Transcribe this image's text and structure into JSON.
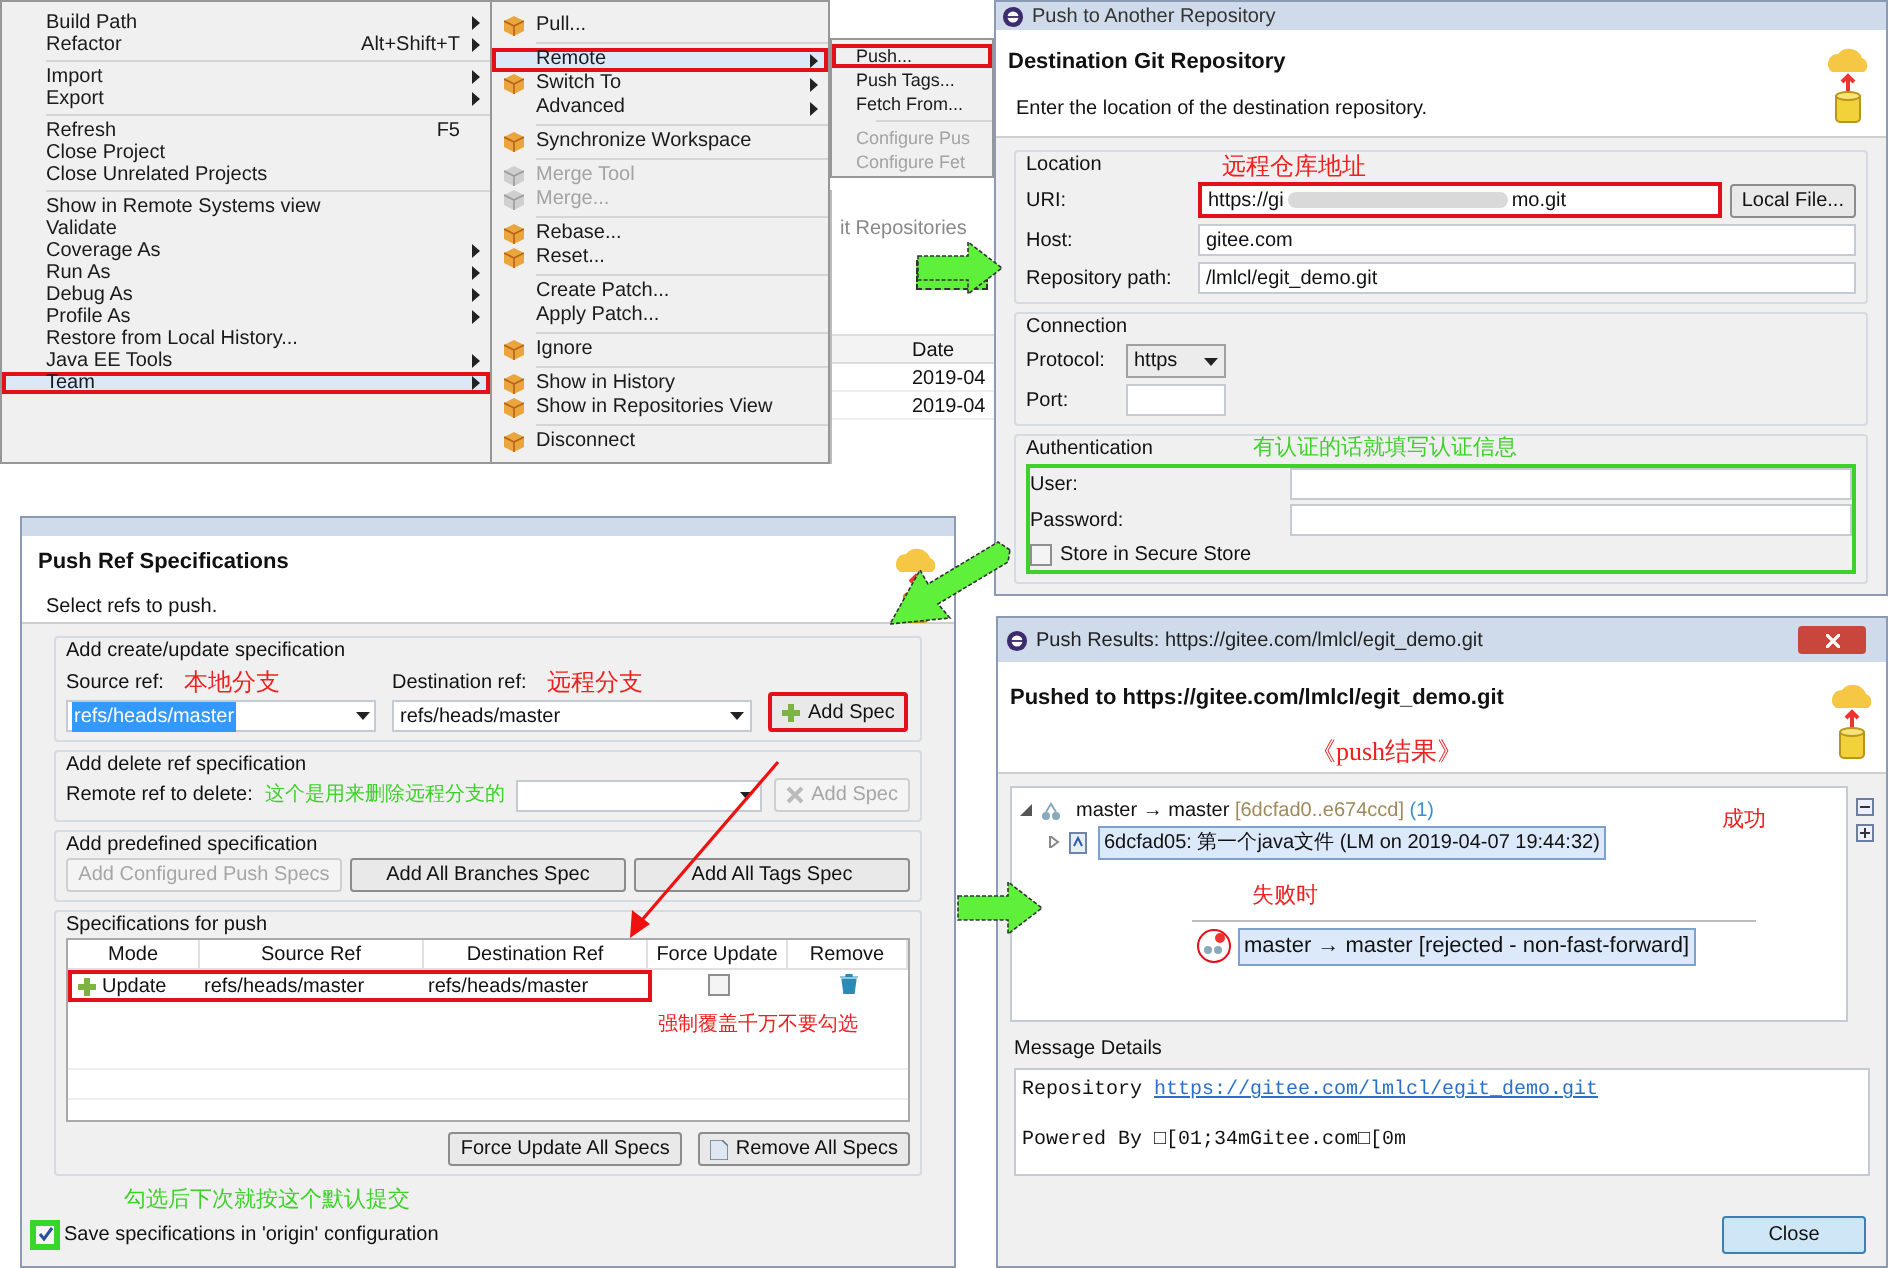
{
  "context_menu": {
    "groups": [
      [
        {
          "label": "Build Path",
          "submenu": true,
          "selected": false,
          "highlighted": false,
          "disabled": false
        },
        {
          "label": "Refactor",
          "shortcut": "Alt+Shift+T",
          "submenu": true,
          "selected": false,
          "highlighted": false,
          "disabled": false
        }
      ],
      [
        {
          "label": "Import",
          "submenu": true,
          "selected": false,
          "highlighted": false,
          "disabled": false
        },
        {
          "label": "Export",
          "submenu": true,
          "selected": false,
          "highlighted": false,
          "disabled": false
        }
      ],
      [
        {
          "label": "Refresh",
          "shortcut": "F5",
          "submenu": false,
          "selected": false,
          "highlighted": false,
          "disabled": false
        },
        {
          "label": "Close Project",
          "submenu": false,
          "selected": false,
          "highlighted": false,
          "disabled": false
        },
        {
          "label": "Close Unrelated Projects",
          "submenu": false,
          "selected": false,
          "highlighted": false,
          "disabled": false
        }
      ],
      [
        {
          "label": "Show in Remote Systems view",
          "submenu": false,
          "selected": false,
          "highlighted": false,
          "disabled": false
        },
        {
          "label": "Validate",
          "submenu": false,
          "selected": false,
          "highlighted": false,
          "disabled": false
        },
        {
          "label": "Coverage As",
          "submenu": true,
          "selected": false,
          "highlighted": false,
          "disabled": false
        },
        {
          "label": "Run As",
          "submenu": true,
          "selected": false,
          "highlighted": false,
          "disabled": false
        },
        {
          "label": "Debug As",
          "submenu": true,
          "selected": false,
          "highlighted": false,
          "disabled": false
        },
        {
          "label": "Profile As",
          "submenu": true,
          "selected": false,
          "highlighted": false,
          "disabled": false
        },
        {
          "label": "Restore from Local History...",
          "submenu": false,
          "selected": false,
          "highlighted": false,
          "disabled": false
        },
        {
          "label": "Java EE Tools",
          "submenu": true,
          "selected": false,
          "highlighted": false,
          "disabled": false
        },
        {
          "label": "Team",
          "submenu": true,
          "selected": true,
          "highlighted": true,
          "disabled": false
        }
      ]
    ]
  },
  "team_menu": {
    "groups": [
      [
        {
          "label": "Pull...",
          "icon": true,
          "submenu": false,
          "selected": false,
          "highlighted": false,
          "disabled": false
        }
      ],
      [
        {
          "label": "Remote",
          "icon": false,
          "submenu": true,
          "selected": true,
          "highlighted": true,
          "disabled": false
        },
        {
          "label": "Switch To",
          "icon": true,
          "submenu": true,
          "selected": false,
          "highlighted": false,
          "disabled": false
        },
        {
          "label": "Advanced",
          "icon": false,
          "submenu": true,
          "selected": false,
          "highlighted": false,
          "disabled": false
        }
      ],
      [
        {
          "label": "Synchronize Workspace",
          "icon": true,
          "submenu": false,
          "selected": false,
          "highlighted": false,
          "disabled": false
        }
      ],
      [
        {
          "label": "Merge Tool",
          "icon": true,
          "submenu": false,
          "selected": false,
          "highlighted": false,
          "disabled": true
        },
        {
          "label": "Merge...",
          "icon": true,
          "submenu": false,
          "selected": false,
          "highlighted": false,
          "disabled": true
        }
      ],
      [
        {
          "label": "Rebase...",
          "icon": true,
          "submenu": false,
          "selected": false,
          "highlighted": false,
          "disabled": false
        },
        {
          "label": "Reset...",
          "icon": true,
          "submenu": false,
          "selected": false,
          "highlighted": false,
          "disabled": false
        }
      ],
      [
        {
          "label": "Create Patch...",
          "icon": false,
          "submenu": false,
          "selected": false,
          "highlighted": false,
          "disabled": false
        },
        {
          "label": "Apply Patch...",
          "icon": false,
          "submenu": false,
          "selected": false,
          "highlighted": false,
          "disabled": false
        }
      ],
      [
        {
          "label": "Ignore",
          "icon": true,
          "submenu": false,
          "selected": false,
          "highlighted": false,
          "disabled": false
        }
      ],
      [
        {
          "label": "Show in History",
          "icon": true,
          "submenu": false,
          "selected": false,
          "highlighted": false,
          "disabled": false
        },
        {
          "label": "Show in Repositories View",
          "icon": true,
          "submenu": false,
          "selected": false,
          "highlighted": false,
          "disabled": false
        }
      ],
      [
        {
          "label": "Disconnect",
          "icon": true,
          "submenu": false,
          "selected": false,
          "highlighted": false,
          "disabled": false
        }
      ]
    ]
  },
  "remote_menu": {
    "groups": [
      [
        {
          "label": "Push...",
          "selected": false,
          "highlighted": true,
          "disabled": false
        },
        {
          "label": "Push Tags...",
          "selected": false,
          "highlighted": false,
          "disabled": false
        },
        {
          "label": "Fetch From...",
          "selected": false,
          "highlighted": false,
          "disabled": false
        }
      ],
      [
        {
          "label": "Configure Pus",
          "selected": false,
          "highlighted": false,
          "disabled": true
        },
        {
          "label": "Configure Fet",
          "selected": false,
          "highlighted": false,
          "disabled": true
        }
      ]
    ]
  },
  "background_view": {
    "tab": "it Repositories",
    "column": "Date",
    "rows": [
      "2019-04",
      "2019-04"
    ]
  },
  "push_dialog": {
    "title": "Push to Another Repository",
    "header": "Destination Git Repository",
    "description": "Enter the location of the destination repository.",
    "location": {
      "label": "Location",
      "note": "远程仓库地址",
      "uri_label": "URI:",
      "uri_start": "https://gi",
      "uri_end": "mo.git",
      "uri_highlighted": true,
      "local_file_button": "Local File...",
      "host_label": "Host:",
      "host": "gitee.com",
      "path_label": "Repository path:",
      "path": "/lmlcl/egit_demo.git"
    },
    "connection": {
      "label": "Connection",
      "protocol_label": "Protocol:",
      "protocol": "https",
      "port_label": "Port:"
    },
    "authentication": {
      "label": "Authentication",
      "note": "有认证的话就填写认证信息",
      "highlighted": true,
      "user_label": "User:",
      "password_label": "Password:",
      "store_label": "Store in Secure Store",
      "store_checked": false
    }
  },
  "ref_spec_dialog": {
    "header": "Push Ref Specifications",
    "description": "Select refs to push.",
    "create_group": {
      "label": "Add create/update specification",
      "source_label": "Source ref:",
      "source_note": "本地分支",
      "destination_label": "Destination ref:",
      "destination_note": "远程分支",
      "source_value": "refs/heads/master",
      "destination_value": "refs/heads/master",
      "add_button": "Add Spec",
      "add_highlighted": true
    },
    "delete_group": {
      "label": "Add delete ref specification",
      "remote_label": "Remote ref to delete:",
      "note": "这个是用来删除远程分支的",
      "add_button": "Add Spec",
      "add_disabled": true
    },
    "predefined_group": {
      "label": "Add predefined specification",
      "buttons": [
        {
          "label": "Add Configured Push Specs",
          "disabled": true
        },
        {
          "label": "Add All Branches Spec",
          "disabled": false
        },
        {
          "label": "Add All Tags Spec",
          "disabled": false
        }
      ]
    },
    "specs_group": {
      "label": "Specifications for push",
      "columns": [
        "Mode",
        "Source Ref",
        "Destination Ref",
        "Force Update",
        "Remove"
      ],
      "rows": [
        {
          "mode": "Update",
          "source": "refs/heads/master",
          "destination": "refs/heads/master",
          "force": false,
          "highlighted": true
        }
      ],
      "force_note": "强制覆盖千万不要勾选",
      "force_all_button": "Force Update All Specs",
      "remove_all_button": "Remove All Specs"
    },
    "save": {
      "note": "勾选后下次就按这个默认提交",
      "label": "Save specifications in 'origin' configuration",
      "checked": true
    }
  },
  "results_dialog": {
    "title": "Push Results: https://gitee.com/lmlcl/egit_demo.git",
    "header": "Pushed to https://gitee.com/lmlcl/egit_demo.git",
    "note": "《push结果》",
    "tree": [
      {
        "label": "master → master",
        "range": "[6dcfad0..e674ccd]",
        "count": "(1)",
        "expanded": true,
        "selected": false,
        "children": [
          {
            "label": "6dcfad05: 第一个java文件 (LM on 2019-04-07 19:44:32)",
            "expanded": false,
            "selected": true
          }
        ]
      }
    ],
    "success_note": "成功",
    "failure_note": "失败时",
    "failure_row": {
      "label": "master → master [rejected - non-fast-forward]",
      "selected": true
    },
    "details_label": "Message Details",
    "repository_label": "Repository",
    "repository_link": "https://gitee.com/lmlcl/egit_demo.git",
    "powered_by": "Powered By □[01;34mGitee.com□[0m",
    "close_button": "Close"
  }
}
